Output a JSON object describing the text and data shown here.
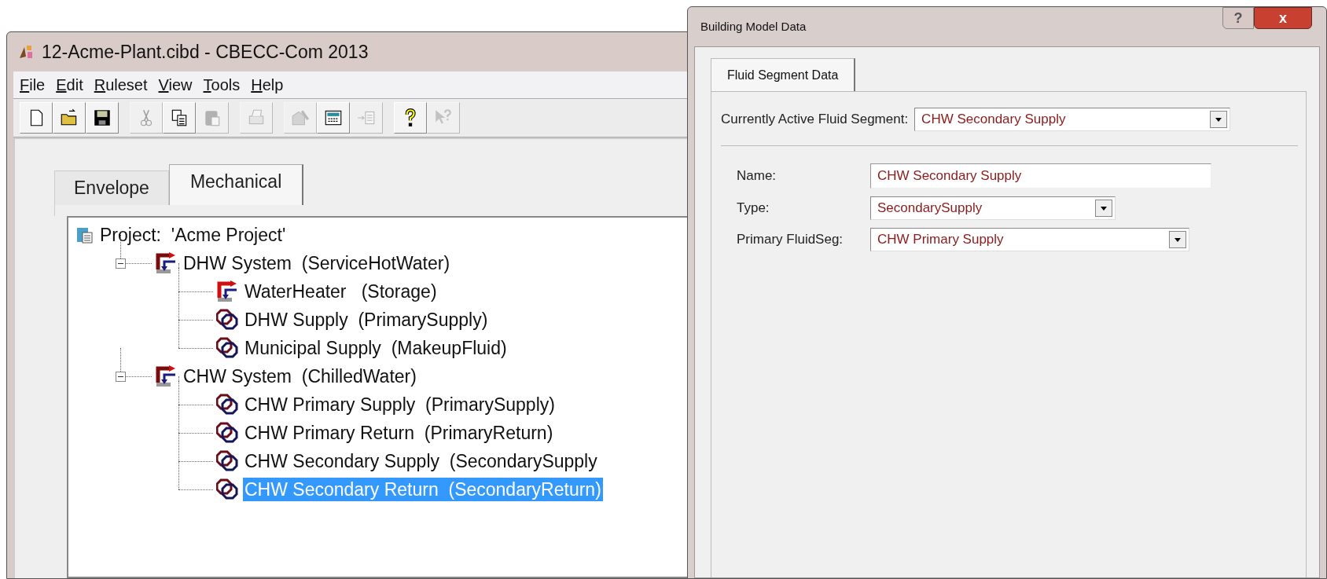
{
  "main_window": {
    "title": "12-Acme-Plant.cibd - CBECC-Com 2013",
    "menu": [
      "File",
      "Edit",
      "Ruleset",
      "View",
      "Tools",
      "Help"
    ],
    "toolbar": [
      [
        {
          "kind": "new",
          "disabled": false
        },
        {
          "kind": "open",
          "disabled": false
        },
        {
          "kind": "save",
          "disabled": false
        }
      ],
      [
        {
          "kind": "cut",
          "disabled": true
        },
        {
          "kind": "copy",
          "disabled": false
        },
        {
          "kind": "paste",
          "disabled": true
        }
      ],
      [
        {
          "kind": "print",
          "disabled": true
        }
      ],
      [
        {
          "kind": "tool",
          "disabled": true
        },
        {
          "kind": "calculator",
          "disabled": false
        },
        {
          "kind": "import",
          "disabled": true
        }
      ],
      [
        {
          "kind": "help",
          "disabled": false
        },
        {
          "kind": "context-help",
          "disabled": true
        }
      ]
    ],
    "tabs": [
      {
        "label": "Envelope",
        "selected": false
      },
      {
        "label": "Mechanical",
        "selected": true
      }
    ],
    "tree": [
      {
        "kind": "project",
        "label": "Project:  'Acme Project'",
        "selected": false,
        "children": [
          {
            "kind": "system",
            "label": "DHW System  (ServiceHotWater)",
            "expanded": true,
            "selected": false,
            "children": [
              {
                "kind": "heater",
                "label": "WaterHeater   (Storage)",
                "selected": false
              },
              {
                "kind": "fluid",
                "label": "DHW Supply  (PrimarySupply)",
                "selected": false
              },
              {
                "kind": "fluid",
                "label": "Municipal Supply  (MakeupFluid)",
                "selected": false
              }
            ]
          },
          {
            "kind": "system",
            "label": "CHW System  (ChilledWater)",
            "expanded": true,
            "selected": false,
            "children": [
              {
                "kind": "fluid",
                "label": "CHW Primary Supply  (PrimarySupply)",
                "selected": false
              },
              {
                "kind": "fluid",
                "label": "CHW Primary Return  (PrimaryReturn)",
                "selected": false
              },
              {
                "kind": "fluid",
                "label": "CHW Secondary Supply  (SecondarySupply",
                "selected": false
              },
              {
                "kind": "fluid",
                "label": "CHW Secondary Return  (SecondaryReturn)",
                "selected": true
              }
            ]
          }
        ]
      }
    ]
  },
  "dialog": {
    "title": "Building Model Data",
    "title_buttons": [
      "?",
      "x"
    ],
    "tabs": [
      {
        "label": "Fluid Segment Data",
        "selected": true
      }
    ],
    "active_segment": {
      "label": "Currently Active Fluid Segment:",
      "value": "CHW Secondary Supply"
    },
    "fields": [
      {
        "kind": "text",
        "label": "Name:",
        "value": "CHW Secondary Supply"
      },
      {
        "kind": "dropdown",
        "label": "Type:",
        "value": "SecondarySupply"
      },
      {
        "kind": "dropdown-wide",
        "label": "Primary FluidSeg:",
        "value": "CHW Primary Supply"
      }
    ]
  }
}
